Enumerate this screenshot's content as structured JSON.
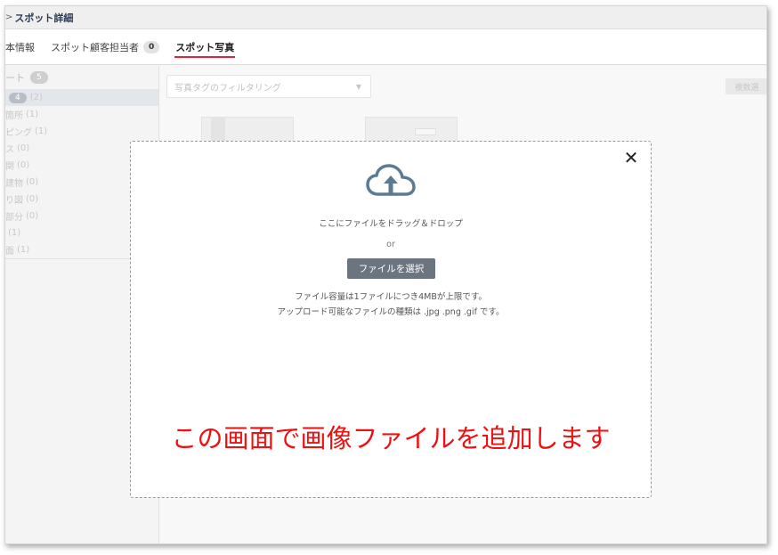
{
  "header": {
    "arrow": ">",
    "title": "スポット詳細"
  },
  "tabs": [
    {
      "label": "本情報",
      "count": null
    },
    {
      "label": "スポット顧客担当者",
      "count": "0"
    },
    {
      "label": "スポット写真",
      "count": null,
      "active": true
    }
  ],
  "sidebar": {
    "head_label": "ート",
    "head_count": "5",
    "items": [
      {
        "pill": "4",
        "label": "(2)",
        "selected": true
      },
      {
        "label": "箇所",
        "count": "(1)"
      },
      {
        "label": "ピング",
        "count": "(1)"
      },
      {
        "label": "ス",
        "count": "(0)"
      },
      {
        "label": "関",
        "count": "(0)"
      },
      {
        "label": "建物",
        "count": "(0)"
      },
      {
        "label": "り図",
        "count": "(0)"
      },
      {
        "label": "部分",
        "count": "(0)"
      },
      {
        "label": "",
        "count": "(1)"
      },
      {
        "label": "面",
        "count": "(1)"
      }
    ]
  },
  "main": {
    "filter_placeholder": "写真タグのフィルタリング",
    "multi_button": "複数選"
  },
  "dropzone": {
    "drag_text": "ここにファイルをドラッグ＆ドロップ",
    "or_text": "or",
    "select_button": "ファイルを選択",
    "note_size": "ファイル容量は1ファイルにつき4MBが上限です。",
    "note_types": "アップロード可能なファイルの種類は .jpg .png .gif です。",
    "close_symbol": "✕"
  },
  "caption": "この画面で画像ファイルを追加します",
  "colors": {
    "accent_red": "#e5243b",
    "caption_red": "#ee1111",
    "button_gray": "#6b7580"
  },
  "icons": {
    "upload": "cloud-upload-icon",
    "close": "close-icon"
  }
}
